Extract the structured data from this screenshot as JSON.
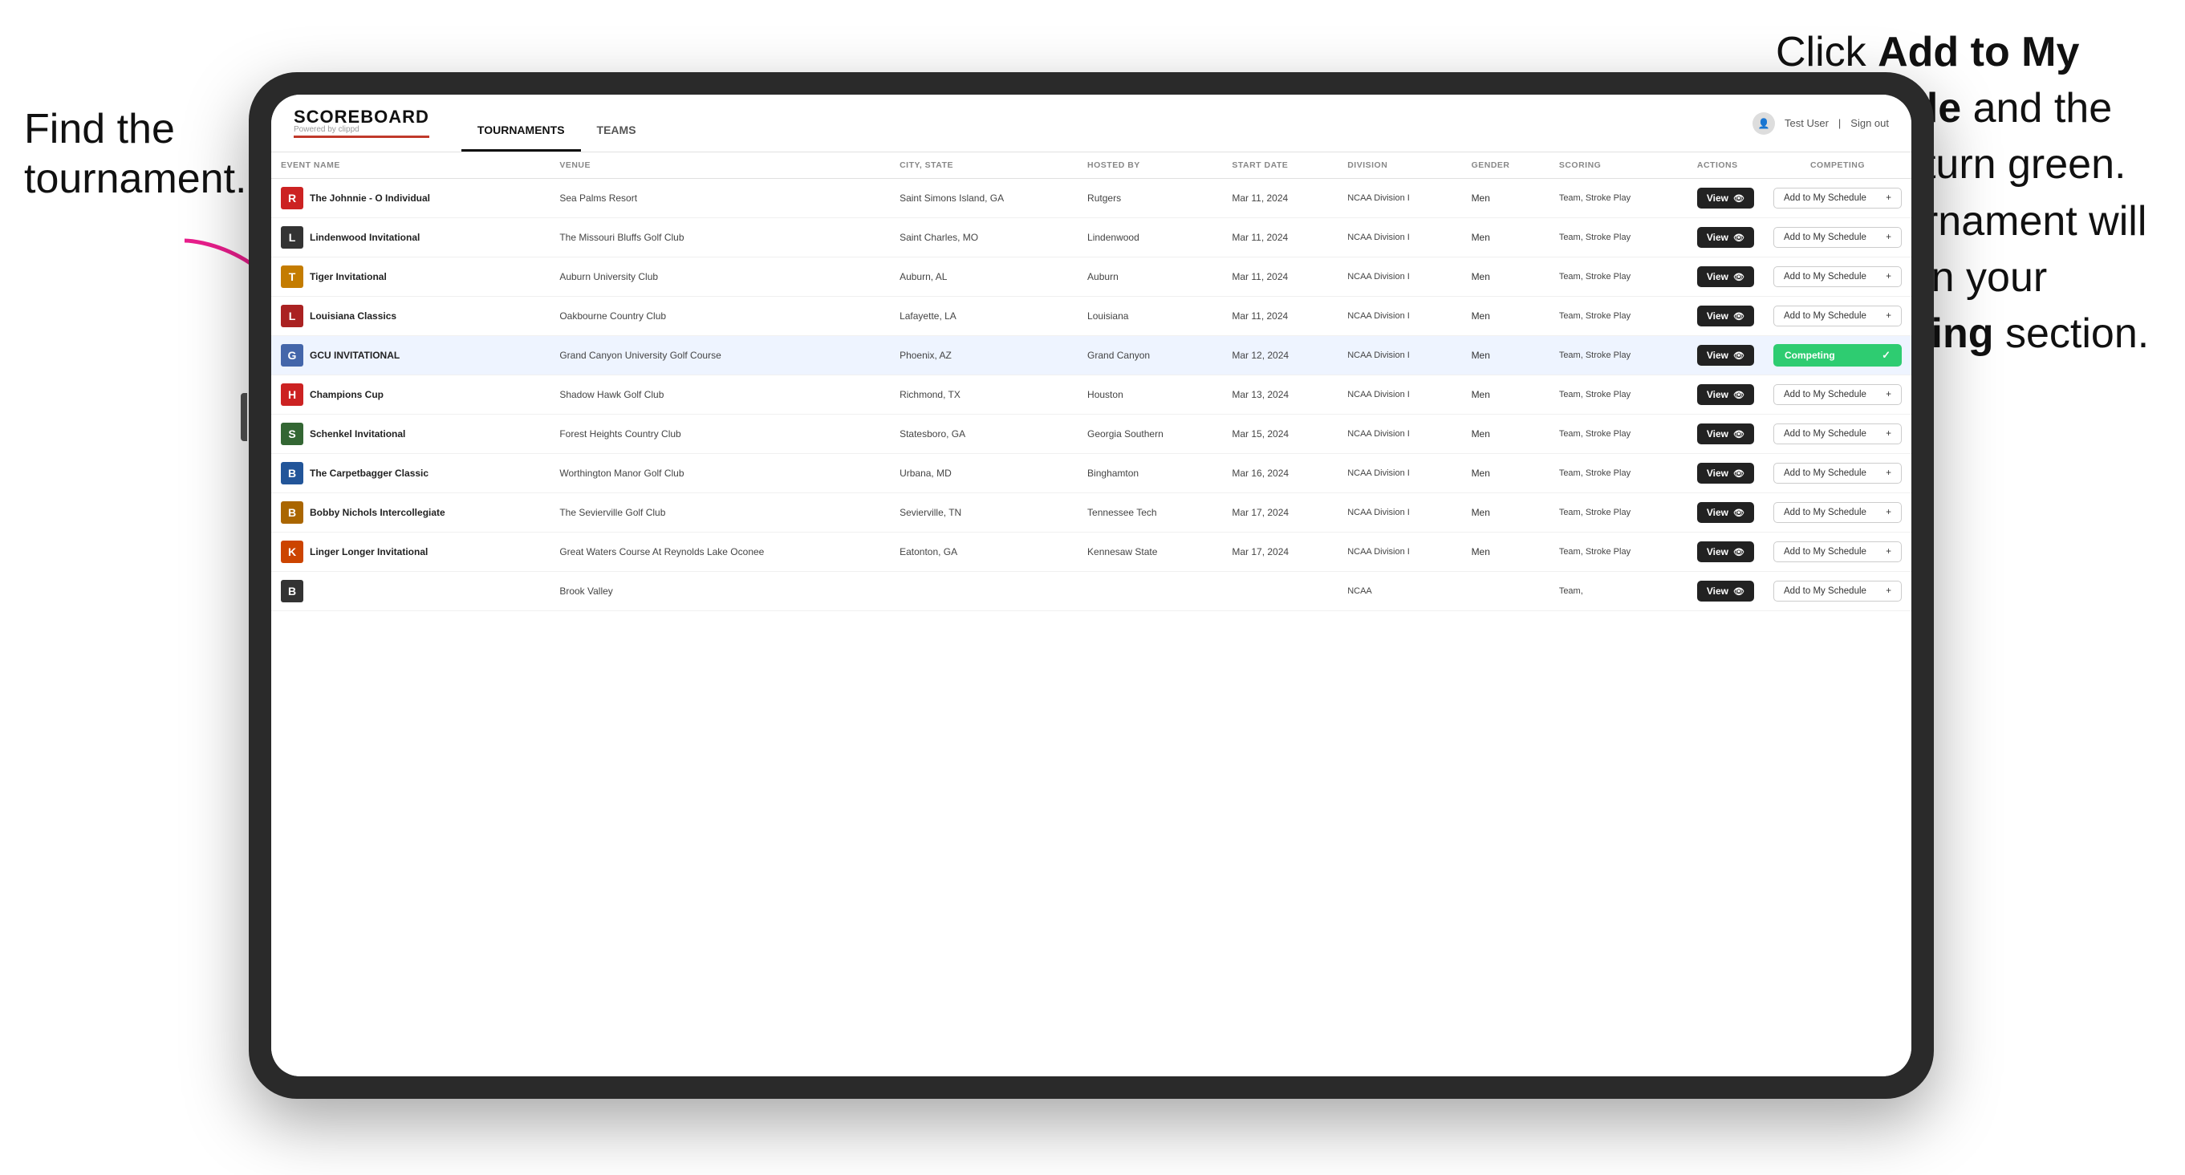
{
  "annotations": {
    "left": "Find the tournament.",
    "right_line1": "Click ",
    "right_bold1": "Add to My Schedule",
    "right_line2": " and the box will turn green. This tournament will now be in your ",
    "right_bold2": "Competing",
    "right_line3": " section."
  },
  "header": {
    "logo": "SCOREBOARD",
    "logo_sub": "Powered by clippd",
    "nav_tabs": [
      "TOURNAMENTS",
      "TEAMS"
    ],
    "active_tab": "TOURNAMENTS",
    "user": "Test User",
    "sign_out": "Sign out"
  },
  "table": {
    "columns": [
      "EVENT NAME",
      "VENUE",
      "CITY, STATE",
      "HOSTED BY",
      "START DATE",
      "DIVISION",
      "GENDER",
      "SCORING",
      "ACTIONS",
      "COMPETING"
    ],
    "rows": [
      {
        "logo_letter": "R",
        "logo_color": "#cc2222",
        "event": "The Johnnie - O Individual",
        "venue": "Sea Palms Resort",
        "city": "Saint Simons Island, GA",
        "hosted": "Rutgers",
        "date": "Mar 11, 2024",
        "division": "NCAA Division I",
        "gender": "Men",
        "scoring": "Team, Stroke Play",
        "competing": false,
        "highlighted": false
      },
      {
        "logo_letter": "L",
        "logo_color": "#333",
        "event": "Lindenwood Invitational",
        "venue": "The Missouri Bluffs Golf Club",
        "city": "Saint Charles, MO",
        "hosted": "Lindenwood",
        "date": "Mar 11, 2024",
        "division": "NCAA Division I",
        "gender": "Men",
        "scoring": "Team, Stroke Play",
        "competing": false,
        "highlighted": false
      },
      {
        "logo_letter": "T",
        "logo_color": "#c47c00",
        "event": "Tiger Invitational",
        "venue": "Auburn University Club",
        "city": "Auburn, AL",
        "hosted": "Auburn",
        "date": "Mar 11, 2024",
        "division": "NCAA Division I",
        "gender": "Men",
        "scoring": "Team, Stroke Play",
        "competing": false,
        "highlighted": false
      },
      {
        "logo_letter": "L",
        "logo_color": "#aa2222",
        "event": "Louisiana Classics",
        "venue": "Oakbourne Country Club",
        "city": "Lafayette, LA",
        "hosted": "Louisiana",
        "date": "Mar 11, 2024",
        "division": "NCAA Division I",
        "gender": "Men",
        "scoring": "Team, Stroke Play",
        "competing": false,
        "highlighted": false
      },
      {
        "logo_letter": "G",
        "logo_color": "#4466aa",
        "event": "GCU INVITATIONAL",
        "venue": "Grand Canyon University Golf Course",
        "city": "Phoenix, AZ",
        "hosted": "Grand Canyon",
        "date": "Mar 12, 2024",
        "division": "NCAA Division I",
        "gender": "Men",
        "scoring": "Team, Stroke Play",
        "competing": true,
        "highlighted": true
      },
      {
        "logo_letter": "H",
        "logo_color": "#cc2222",
        "event": "Champions Cup",
        "venue": "Shadow Hawk Golf Club",
        "city": "Richmond, TX",
        "hosted": "Houston",
        "date": "Mar 13, 2024",
        "division": "NCAA Division I",
        "gender": "Men",
        "scoring": "Team, Stroke Play",
        "competing": false,
        "highlighted": false
      },
      {
        "logo_letter": "S",
        "logo_color": "#336633",
        "event": "Schenkel Invitational",
        "venue": "Forest Heights Country Club",
        "city": "Statesboro, GA",
        "hosted": "Georgia Southern",
        "date": "Mar 15, 2024",
        "division": "NCAA Division I",
        "gender": "Men",
        "scoring": "Team, Stroke Play",
        "competing": false,
        "highlighted": false
      },
      {
        "logo_letter": "B",
        "logo_color": "#225599",
        "event": "The Carpetbagger Classic",
        "venue": "Worthington Manor Golf Club",
        "city": "Urbana, MD",
        "hosted": "Binghamton",
        "date": "Mar 16, 2024",
        "division": "NCAA Division I",
        "gender": "Men",
        "scoring": "Team, Stroke Play",
        "competing": false,
        "highlighted": false
      },
      {
        "logo_letter": "B",
        "logo_color": "#aa6600",
        "event": "Bobby Nichols Intercollegiate",
        "venue": "The Sevierville Golf Club",
        "city": "Sevierville, TN",
        "hosted": "Tennessee Tech",
        "date": "Mar 17, 2024",
        "division": "NCAA Division I",
        "gender": "Men",
        "scoring": "Team, Stroke Play",
        "competing": false,
        "highlighted": false
      },
      {
        "logo_letter": "K",
        "logo_color": "#cc4400",
        "event": "Linger Longer Invitational",
        "venue": "Great Waters Course At Reynolds Lake Oconee",
        "city": "Eatonton, GA",
        "hosted": "Kennesaw State",
        "date": "Mar 17, 2024",
        "division": "NCAA Division I",
        "gender": "Men",
        "scoring": "Team, Stroke Play",
        "competing": false,
        "highlighted": false
      },
      {
        "logo_letter": "B",
        "logo_color": "#333",
        "event": "",
        "venue": "Brook Valley",
        "city": "",
        "hosted": "",
        "date": "",
        "division": "NCAA",
        "gender": "",
        "scoring": "Team,",
        "competing": false,
        "highlighted": false,
        "partial": true
      }
    ]
  },
  "buttons": {
    "view": "View",
    "add_to_schedule": "Add to My Schedule",
    "competing": "Competing"
  }
}
